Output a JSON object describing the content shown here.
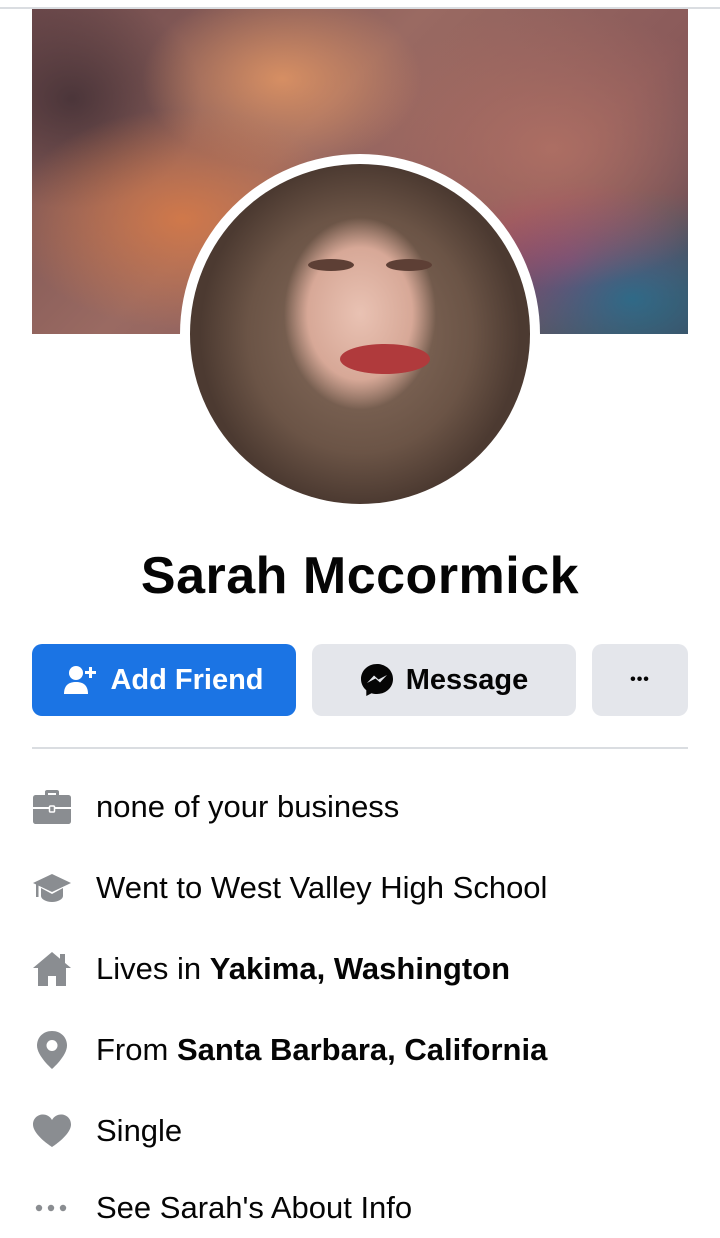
{
  "profile": {
    "name": "Sarah Mccormick"
  },
  "actions": {
    "add_friend_label": "Add Friend",
    "message_label": "Message",
    "more_label": "•••"
  },
  "info": {
    "work": "none of your business",
    "education": "Went to West Valley High School",
    "lives_prefix": "Lives in ",
    "lives_place": "Yakima, Washington",
    "from_prefix": "From ",
    "from_place": "Santa Barbara, California",
    "relationship": "Single",
    "see_about": "See Sarah's About Info"
  },
  "icons": {
    "add_friend": "person-add-icon",
    "message": "messenger-icon",
    "work": "briefcase-icon",
    "education": "graduation-cap-icon",
    "home": "home-icon",
    "location": "location-pin-icon",
    "relationship": "heart-icon",
    "more": "more-dots-icon"
  },
  "colors": {
    "primary": "#1b74e4",
    "secondary_button": "#e4e6eb",
    "icon_gray": "#8a8d91"
  }
}
